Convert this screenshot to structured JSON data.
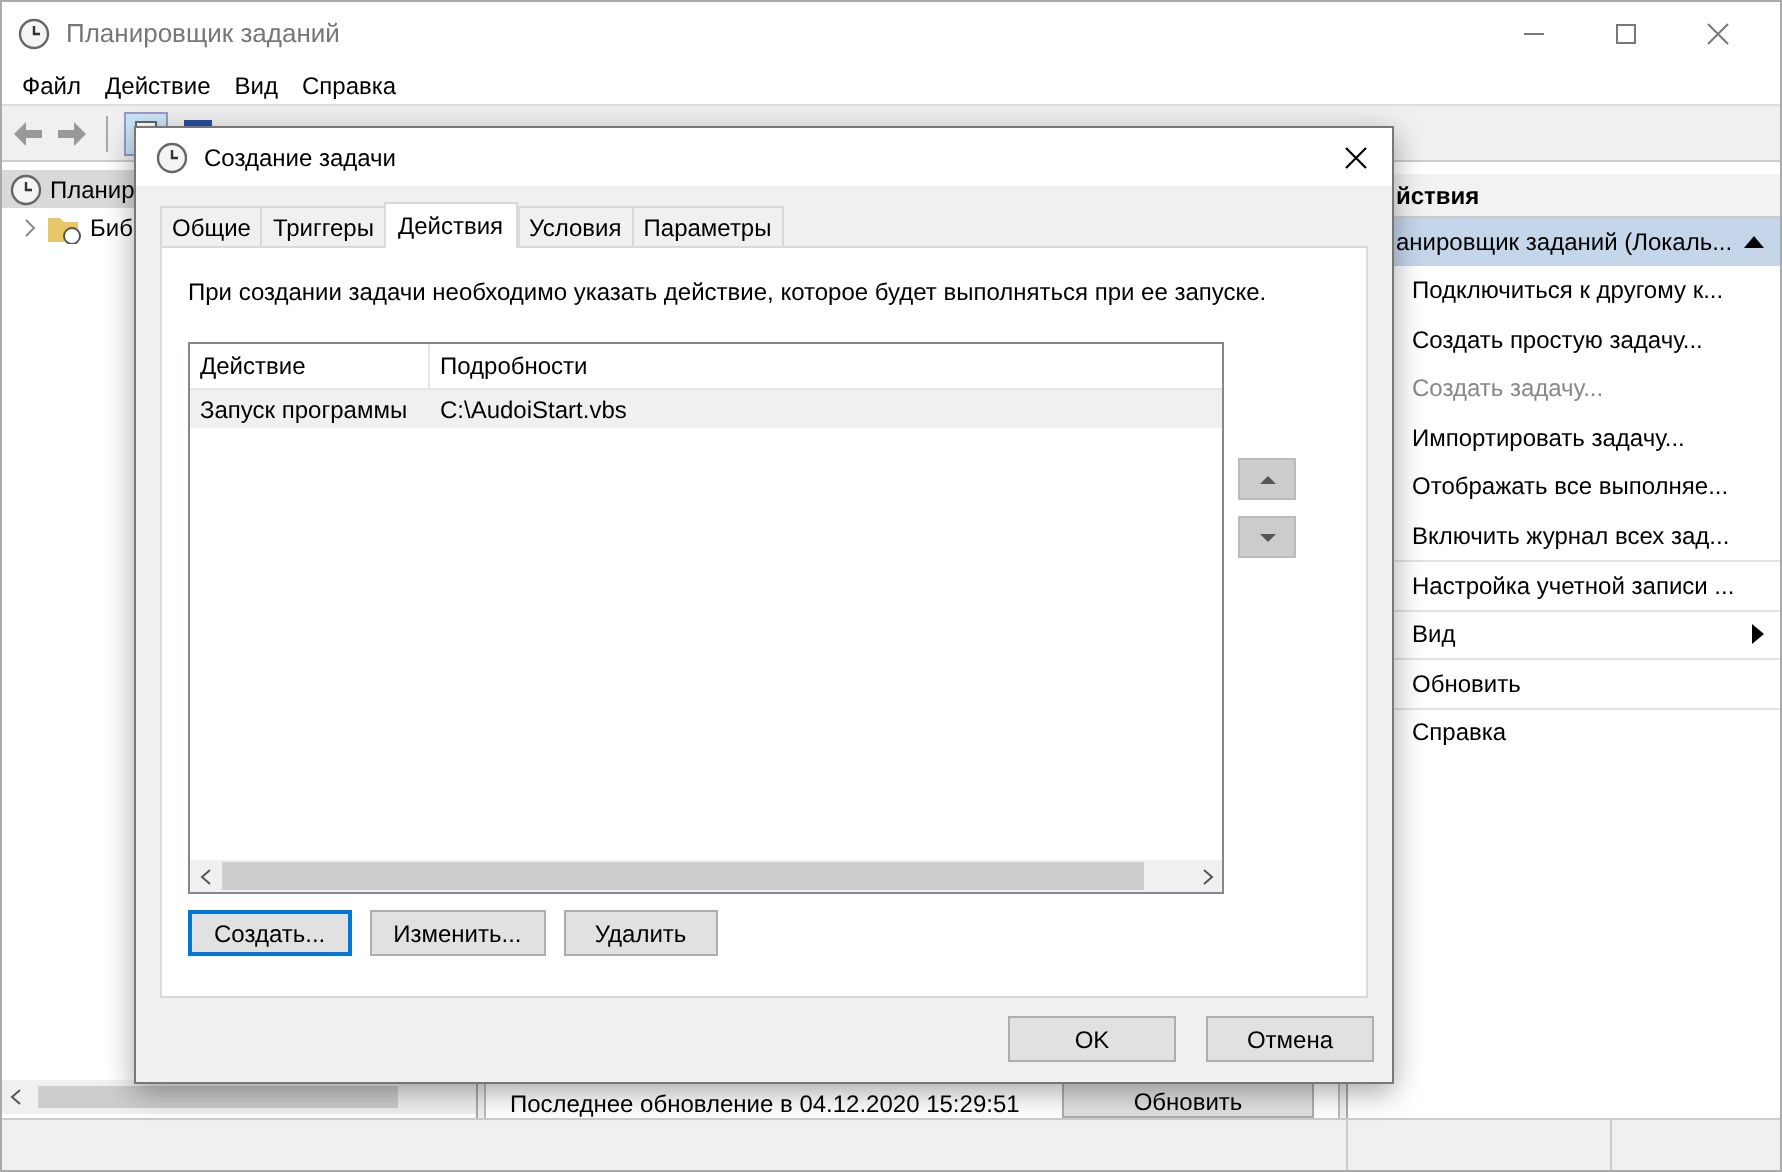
{
  "window": {
    "title": "Планировщик заданий"
  },
  "menu": [
    "Файл",
    "Действие",
    "Вид",
    "Справка"
  ],
  "tree": [
    {
      "label": "Планир",
      "selected": true,
      "expanded": true,
      "children": [
        {
          "label": "Биб",
          "selected": false
        }
      ]
    }
  ],
  "center": {
    "status": "Последнее обновление в 04.12.2020 15:29:51",
    "refresh_button": "Обновить"
  },
  "actions_pane": {
    "header": "йствия",
    "items": [
      {
        "kind": "group",
        "label": "анировщик заданий (Локаль..."
      },
      {
        "kind": "item",
        "label": "Подключиться к другому к...",
        "disabled": false,
        "separator": false
      },
      {
        "kind": "item",
        "label": "Создать простую задачу...",
        "disabled": false,
        "separator": false
      },
      {
        "kind": "item",
        "label": "Создать задачу...",
        "disabled": true,
        "separator": false
      },
      {
        "kind": "item",
        "label": "Импортировать задачу...",
        "disabled": false,
        "separator": false
      },
      {
        "kind": "item",
        "label": "Отображать все выполняе...",
        "disabled": false,
        "separator": false
      },
      {
        "kind": "item",
        "label": "Включить журнал всех зад...",
        "disabled": false,
        "separator": false
      },
      {
        "kind": "item",
        "label": "Настройка учетной записи ...",
        "disabled": false,
        "separator": true
      },
      {
        "kind": "submenu",
        "label": "Вид",
        "disabled": false,
        "separator": true
      },
      {
        "kind": "item",
        "label": "Обновить",
        "disabled": false,
        "separator": true
      },
      {
        "kind": "item",
        "label": "Справка",
        "disabled": false,
        "separator": true
      }
    ]
  },
  "dialog": {
    "title": "Создание задачи",
    "tabs": [
      {
        "label": "Общие",
        "selected": false
      },
      {
        "label": "Триггеры",
        "selected": false
      },
      {
        "label": "Действия",
        "selected": true
      },
      {
        "label": "Условия",
        "selected": false
      },
      {
        "label": "Параметры",
        "selected": false
      }
    ],
    "description": "При создании задачи необходимо указать действие, которое будет выполняться при ее запуске.",
    "table": {
      "columns": [
        "Действие",
        "Подробности"
      ],
      "rows": [
        {
          "cells": [
            "Запуск программы",
            "C:\\AudoiStart.vbs"
          ],
          "selected": true
        }
      ]
    },
    "buttons": [
      {
        "label": "Создать...",
        "focused": true
      },
      {
        "label": "Изменить...",
        "focused": false
      },
      {
        "label": "Удалить",
        "focused": false
      }
    ],
    "footer_buttons": [
      "OK",
      "Отмена"
    ]
  }
}
